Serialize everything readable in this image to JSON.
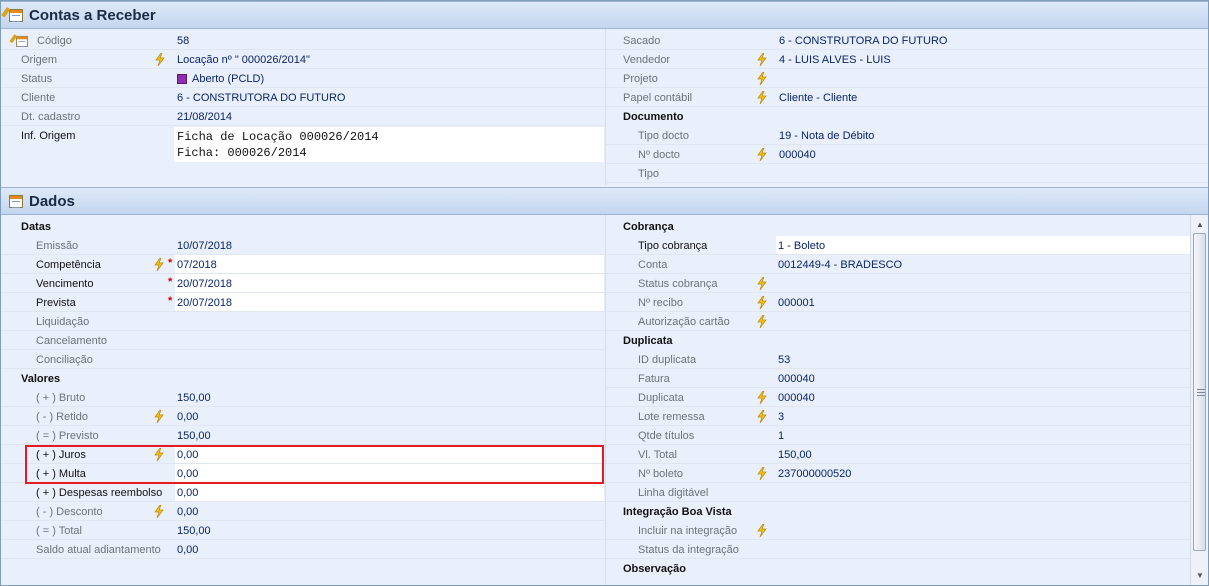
{
  "top_panel": {
    "title": "Contas a Receber",
    "left": [
      {
        "label": "Código",
        "value": "58",
        "icon": "edit-icon"
      },
      {
        "label": "Origem",
        "value": "Locação nº \" 000026/2014\"",
        "bolt": true
      },
      {
        "label": "Status",
        "value": "Aberto (PCLD)",
        "status_color": "#8d2fb0"
      },
      {
        "label": "Cliente",
        "value": "6 - CONSTRUTORA DO FUTURO"
      },
      {
        "label": "Dt. cadastro",
        "value": "21/08/2014"
      },
      {
        "label": "Inf. Origem",
        "lines": [
          "Ficha de Locação 000026/2014",
          "Ficha: 000026/2014"
        ]
      }
    ],
    "right": [
      {
        "label": "Sacado",
        "value": "6 - CONSTRUTORA DO FUTURO"
      },
      {
        "label": "Vendedor",
        "value": "4 - LUIS ALVES - LUIS",
        "bolt": true
      },
      {
        "label": "Projeto",
        "value": "",
        "bolt": true
      },
      {
        "label": "Papel contábil",
        "value": "Cliente - Cliente",
        "bolt": true
      },
      {
        "label": "Documento",
        "category": true
      },
      {
        "label": "Tipo docto",
        "value": "19 - Nota de Débito"
      },
      {
        "label": "Nº docto",
        "value": "000040",
        "bolt": true
      },
      {
        "label": "Tipo",
        "value": ""
      }
    ]
  },
  "dados_panel": {
    "title": "Dados",
    "left": [
      {
        "label": "Datas",
        "category": true
      },
      {
        "label": "Emissão",
        "value": "10/07/2018"
      },
      {
        "label": "Competência",
        "value": "07/2018",
        "bolt": true,
        "required": true,
        "active": true
      },
      {
        "label": "Vencimento",
        "value": "20/07/2018",
        "required": true,
        "active": true
      },
      {
        "label": "Prevista",
        "value": "20/07/2018",
        "required": true,
        "active": true
      },
      {
        "label": "Liquidação",
        "value": ""
      },
      {
        "label": "Cancelamento",
        "value": ""
      },
      {
        "label": "Conciliação",
        "value": ""
      },
      {
        "label": "Valores",
        "category": true
      },
      {
        "label": "( + ) Bruto",
        "value": "150,00"
      },
      {
        "label": "( - ) Retido",
        "value": "0,00",
        "bolt": true
      },
      {
        "label": "( = ) Previsto",
        "value": "150,00"
      },
      {
        "label": "( + ) Juros",
        "value": "0,00",
        "bolt": true,
        "active": true
      },
      {
        "label": "( + ) Multa",
        "value": "0,00",
        "active": true
      },
      {
        "label": "( + ) Despesas reembolso",
        "value": "0,00",
        "active": true
      },
      {
        "label": "( - ) Desconto",
        "value": "0,00",
        "bolt": true
      },
      {
        "label": "( = ) Total",
        "value": "150,00"
      },
      {
        "label": "Saldo atual adiantamento",
        "value": "0,00",
        "indent_small": true
      }
    ],
    "right": [
      {
        "label": "Cobrança",
        "category": true
      },
      {
        "label": "Tipo cobrança",
        "value": "1 - Boleto",
        "active": true
      },
      {
        "label": "Conta",
        "value": "0012449-4 - BRADESCO"
      },
      {
        "label": "Status cobrança",
        "value": "",
        "bolt": true
      },
      {
        "label": "Nº recibo",
        "value": "000001",
        "bolt": true
      },
      {
        "label": "Autorização cartão",
        "value": "",
        "bolt": true
      },
      {
        "label": "Duplicata",
        "category": true
      },
      {
        "label": "ID duplicata",
        "value": "53"
      },
      {
        "label": "Fatura",
        "value": "000040"
      },
      {
        "label": "Duplicata",
        "value": "000040",
        "bolt": true
      },
      {
        "label": "Lote remessa",
        "value": "3",
        "bolt": true
      },
      {
        "label": "Qtde títulos",
        "value": "1"
      },
      {
        "label": "Vl. Total",
        "value": "150,00"
      },
      {
        "label": "Nº boleto",
        "value": "237000000520",
        "bolt": true
      },
      {
        "label": "Linha digitável",
        "value": ""
      },
      {
        "label": "Integração Boa Vista",
        "category": true
      },
      {
        "label": "Incluir na integração",
        "value": "",
        "bolt": true
      },
      {
        "label": "Status da integração",
        "value": ""
      },
      {
        "label": "Observação",
        "category": true
      }
    ]
  },
  "colors": {
    "value_text": "#0a246a",
    "label_text": "#6d7278",
    "required": "#d10000",
    "highlight": "#e31b23",
    "header_bg": "#c4d6ef"
  }
}
